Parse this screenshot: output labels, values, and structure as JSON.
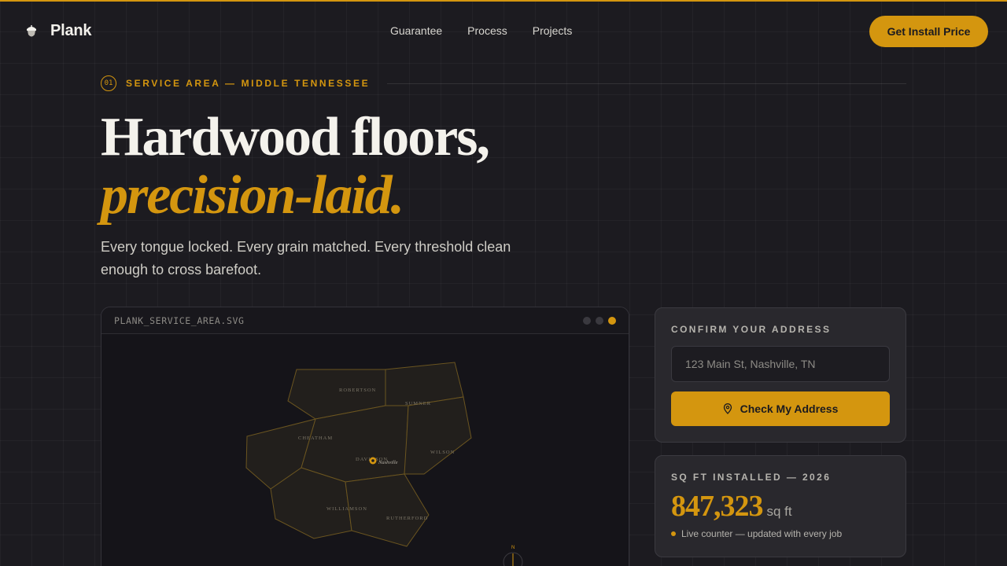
{
  "brand": {
    "name": "Plank",
    "logo_icon": "acorn-icon"
  },
  "nav": {
    "items": [
      "Guarantee",
      "Process",
      "Projects"
    ]
  },
  "header": {
    "cta_label": "Get Install Price"
  },
  "eyebrow": {
    "number": "01",
    "text": "SERVICE AREA — MIDDLE TENNESSEE"
  },
  "hero": {
    "headline_line1": "Hardwood floors,",
    "headline_line2": "precision-laid.",
    "subheadline": "Every tongue locked. Every grain matched. Every threshold clean enough to cross barefoot."
  },
  "map": {
    "title": "PLANK_SERVICE_AREA.SVG",
    "counties": [
      "ROBERTSON",
      "SUMNER",
      "CHEATHAM",
      "DAVIDSON",
      "WILSON",
      "WILLIAMSON",
      "RUTHERFORD"
    ],
    "city_label": "Nashville",
    "compass_label": "N"
  },
  "address_card": {
    "label": "CONFIRM YOUR ADDRESS",
    "input_placeholder": "123 Main St, Nashville, TN",
    "input_value": "",
    "button_label": "Check My Address",
    "button_icon": "map-pin-icon"
  },
  "counter_card": {
    "label": "SQ FT INSTALLED — 2026",
    "value": "847,323",
    "unit": "sq ft",
    "note": "Live counter — updated with every job"
  },
  "colors": {
    "accent": "#d4960f",
    "background": "#1c1b20",
    "card": "#29282d"
  }
}
